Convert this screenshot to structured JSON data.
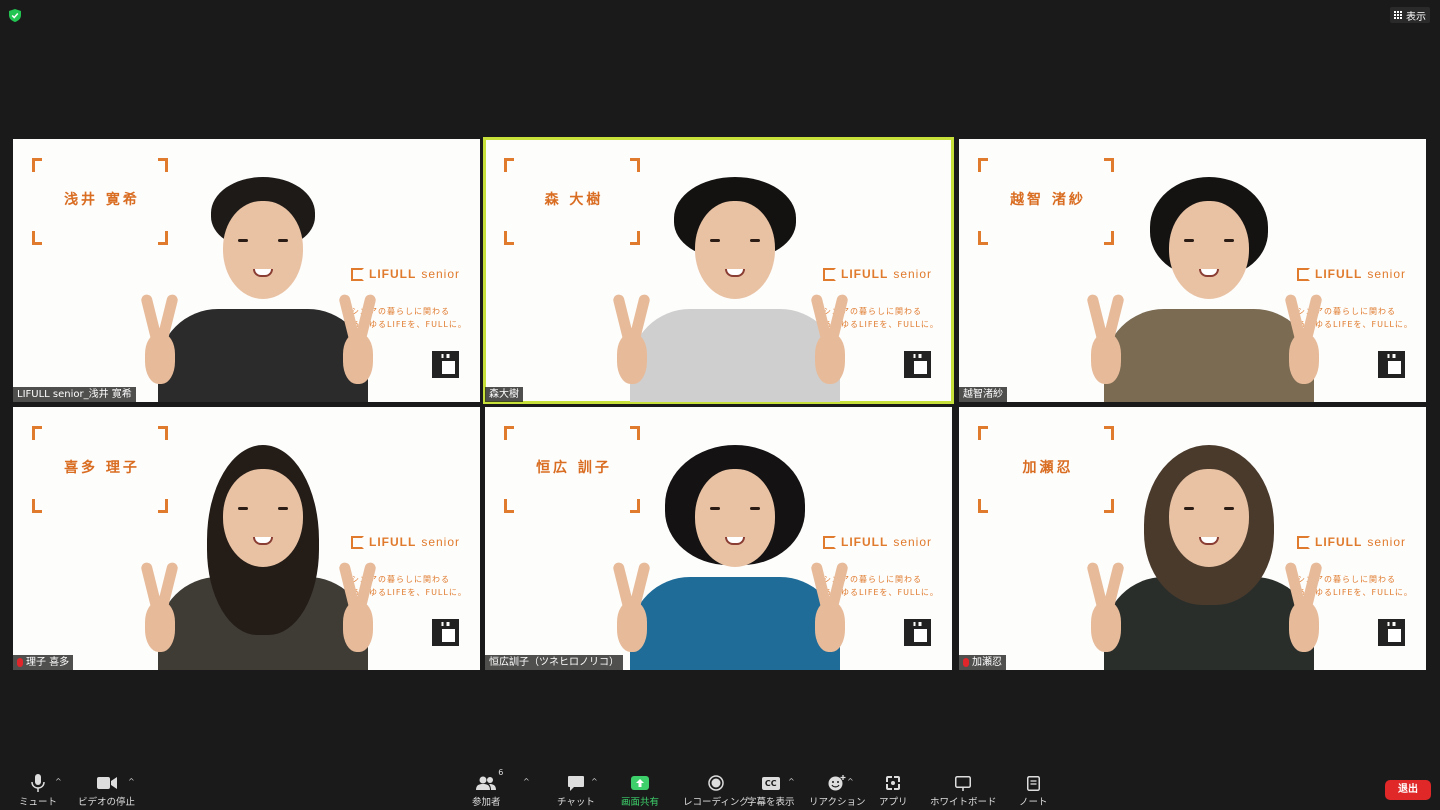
{
  "topbar": {
    "view_label": "表示"
  },
  "tiles": [
    {
      "card_name": "浅井 寛希",
      "label": "LIFULL senior_浅井 寛希",
      "muted": false,
      "active": false
    },
    {
      "card_name": "森 大樹",
      "label": "森大樹",
      "muted": false,
      "active": true
    },
    {
      "card_name": "越智 渚紗",
      "label": "越智渚紗",
      "muted": false,
      "active": false
    },
    {
      "card_name": "喜多 理子",
      "label": "理子 喜多",
      "muted": true,
      "active": false
    },
    {
      "card_name": "恒広 訓子",
      "label": "恒広訓子（ツネヒロノリコ）",
      "muted": false,
      "active": false
    },
    {
      "card_name": "加瀬忍",
      "label": "加瀬忍",
      "muted": true,
      "active": false
    }
  ],
  "background": {
    "logo_brand": "LIFULL",
    "logo_sub": "senior",
    "tagline_1": "シニアの暮らしに関わる",
    "tagline_2": "あらゆるLIFEを、FULLに。"
  },
  "toolbar": {
    "mute": "ミュート",
    "video": "ビデオの停止",
    "participants": "参加者",
    "participants_count": "6",
    "chat": "チャット",
    "share": "画面共有",
    "record": "レコーディング",
    "captions": "字幕を表示",
    "captions_icon": "CC",
    "reactions": "リアクション",
    "apps": "アプリ",
    "whiteboard": "ホワイトボード",
    "notes": "ノート",
    "leave": "退出"
  },
  "colors": {
    "accent_orange": "#e07a2c",
    "active_speaker": "#c7e13a",
    "leave_red": "#e02828",
    "share_green": "#3ed16b"
  }
}
